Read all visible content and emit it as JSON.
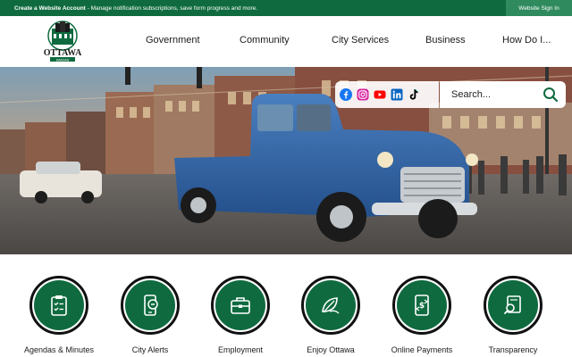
{
  "topbar": {
    "create_label": "Create a Website Account",
    "create_desc": " - Manage notification subscriptions, save form progress and more.",
    "signin_label": "Website Sign In"
  },
  "logo": {
    "name": "OTTAWA",
    "state": "KANSAS"
  },
  "nav": {
    "items": [
      "Government",
      "Community",
      "City Services",
      "Business",
      "How Do I..."
    ]
  },
  "social": {
    "icons": [
      "facebook-icon",
      "instagram-icon",
      "youtube-icon",
      "linkedin-icon",
      "tiktok-icon"
    ]
  },
  "search": {
    "placeholder": "Search..."
  },
  "quick_links": [
    {
      "label": "Agendas & Minutes",
      "icon": "clipboard-icon"
    },
    {
      "label": "City Alerts",
      "icon": "alert-phone-icon"
    },
    {
      "label": "Employment",
      "icon": "briefcase-icon"
    },
    {
      "label": "Enjoy Ottawa",
      "icon": "leaf-icon"
    },
    {
      "label": "Online Payments",
      "icon": "payment-phone-icon"
    },
    {
      "label": "Transparency",
      "icon": "document-search-icon"
    }
  ],
  "colors": {
    "brand_green": "#0f6b3f",
    "topbar_signin": "#2f8a5d",
    "truck_blue": "#2e5fa0"
  }
}
